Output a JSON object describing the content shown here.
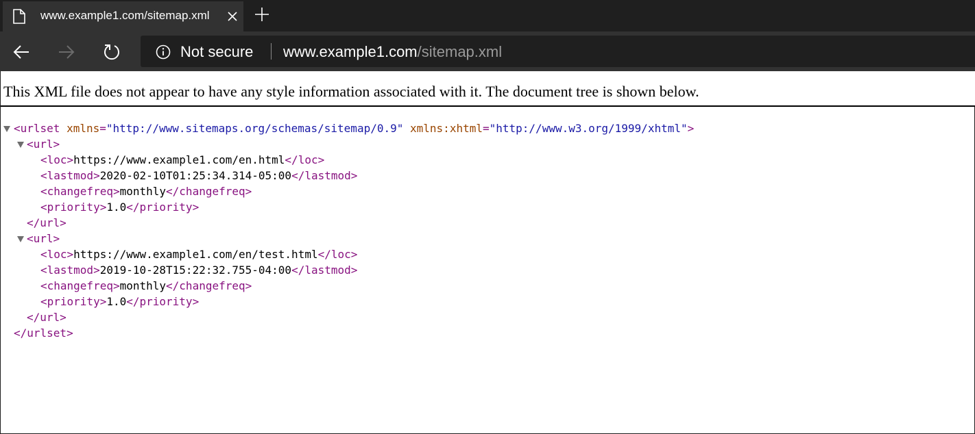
{
  "browser": {
    "tab_title": "www.example1.com/sitemap.xml",
    "security_label": "Not secure",
    "url_host": "www.example1.com",
    "url_path": "/sitemap.xml",
    "icons": [
      "page-icon",
      "close-icon",
      "plus-icon",
      "back-arrow-icon",
      "forward-arrow-icon",
      "reload-icon",
      "info-icon"
    ]
  },
  "banner": {
    "text": "This XML file does not appear to have any style information associated with it. The document tree is shown below."
  },
  "xml": {
    "root_open_name": "<urlset",
    "attr1_name": "xmlns",
    "attr1_value": "\"http://www.sitemaps.org/schemas/sitemap/0.9\"",
    "attr2_name": "xmlns:xhtml",
    "attr2_value": "\"http://www.w3.org/1999/xhtml\"",
    "root_open_end": ">",
    "url_open": "<url>",
    "url_close": "</url>",
    "root_close": "</urlset>",
    "urls": [
      {
        "loc_open": "<loc>",
        "loc": "https://www.example1.com/en.html",
        "loc_close": "</loc>",
        "lastmod_open": "<lastmod>",
        "lastmod": "2020-02-10T01:25:34.314-05:00",
        "lastmod_close": "</lastmod>",
        "changefreq_open": "<changefreq>",
        "changefreq": "monthly",
        "changefreq_close": "</changefreq>",
        "priority_open": "<priority>",
        "priority": "1.0",
        "priority_close": "</priority>"
      },
      {
        "loc_open": "<loc>",
        "loc": "https://www.example1.com/en/test.html",
        "loc_close": "</loc>",
        "lastmod_open": "<lastmod>",
        "lastmod": "2019-10-28T15:22:32.755-04:00",
        "lastmod_close": "</lastmod>",
        "changefreq_open": "<changefreq>",
        "changefreq": "monthly",
        "changefreq_close": "</changefreq>",
        "priority_open": "<priority>",
        "priority": "1.0",
        "priority_close": "</priority>"
      }
    ]
  }
}
